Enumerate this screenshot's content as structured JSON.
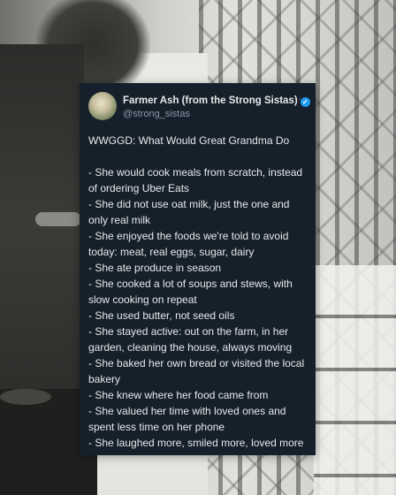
{
  "tweet": {
    "display_name": "Farmer Ash (from the Strong Sistas)",
    "handle": "@strong_sistas",
    "lines": [
      "WWGGD: What Would Great Grandma Do",
      "",
      "- She would cook meals from scratch, instead",
      "of ordering Uber Eats",
      "- She did not use oat milk, just the one and",
      "only real milk",
      "- She enjoyed the foods we're told to avoid",
      "today: meat, real eggs, sugar, dairy",
      "- She ate produce in season",
      "- She cooked a lot of soups and stews, with",
      "slow cooking on repeat",
      "- She used butter, not seed oils",
      "- She stayed active: out on the farm, in her",
      "garden, cleaning the house, always moving",
      "- She baked her own bread or visited the local",
      "bakery",
      "- She knew where her food came from",
      "- She valued her time with loved ones and",
      "spent less time on her phone",
      "- She laughed more, smiled more, loved more"
    ]
  }
}
